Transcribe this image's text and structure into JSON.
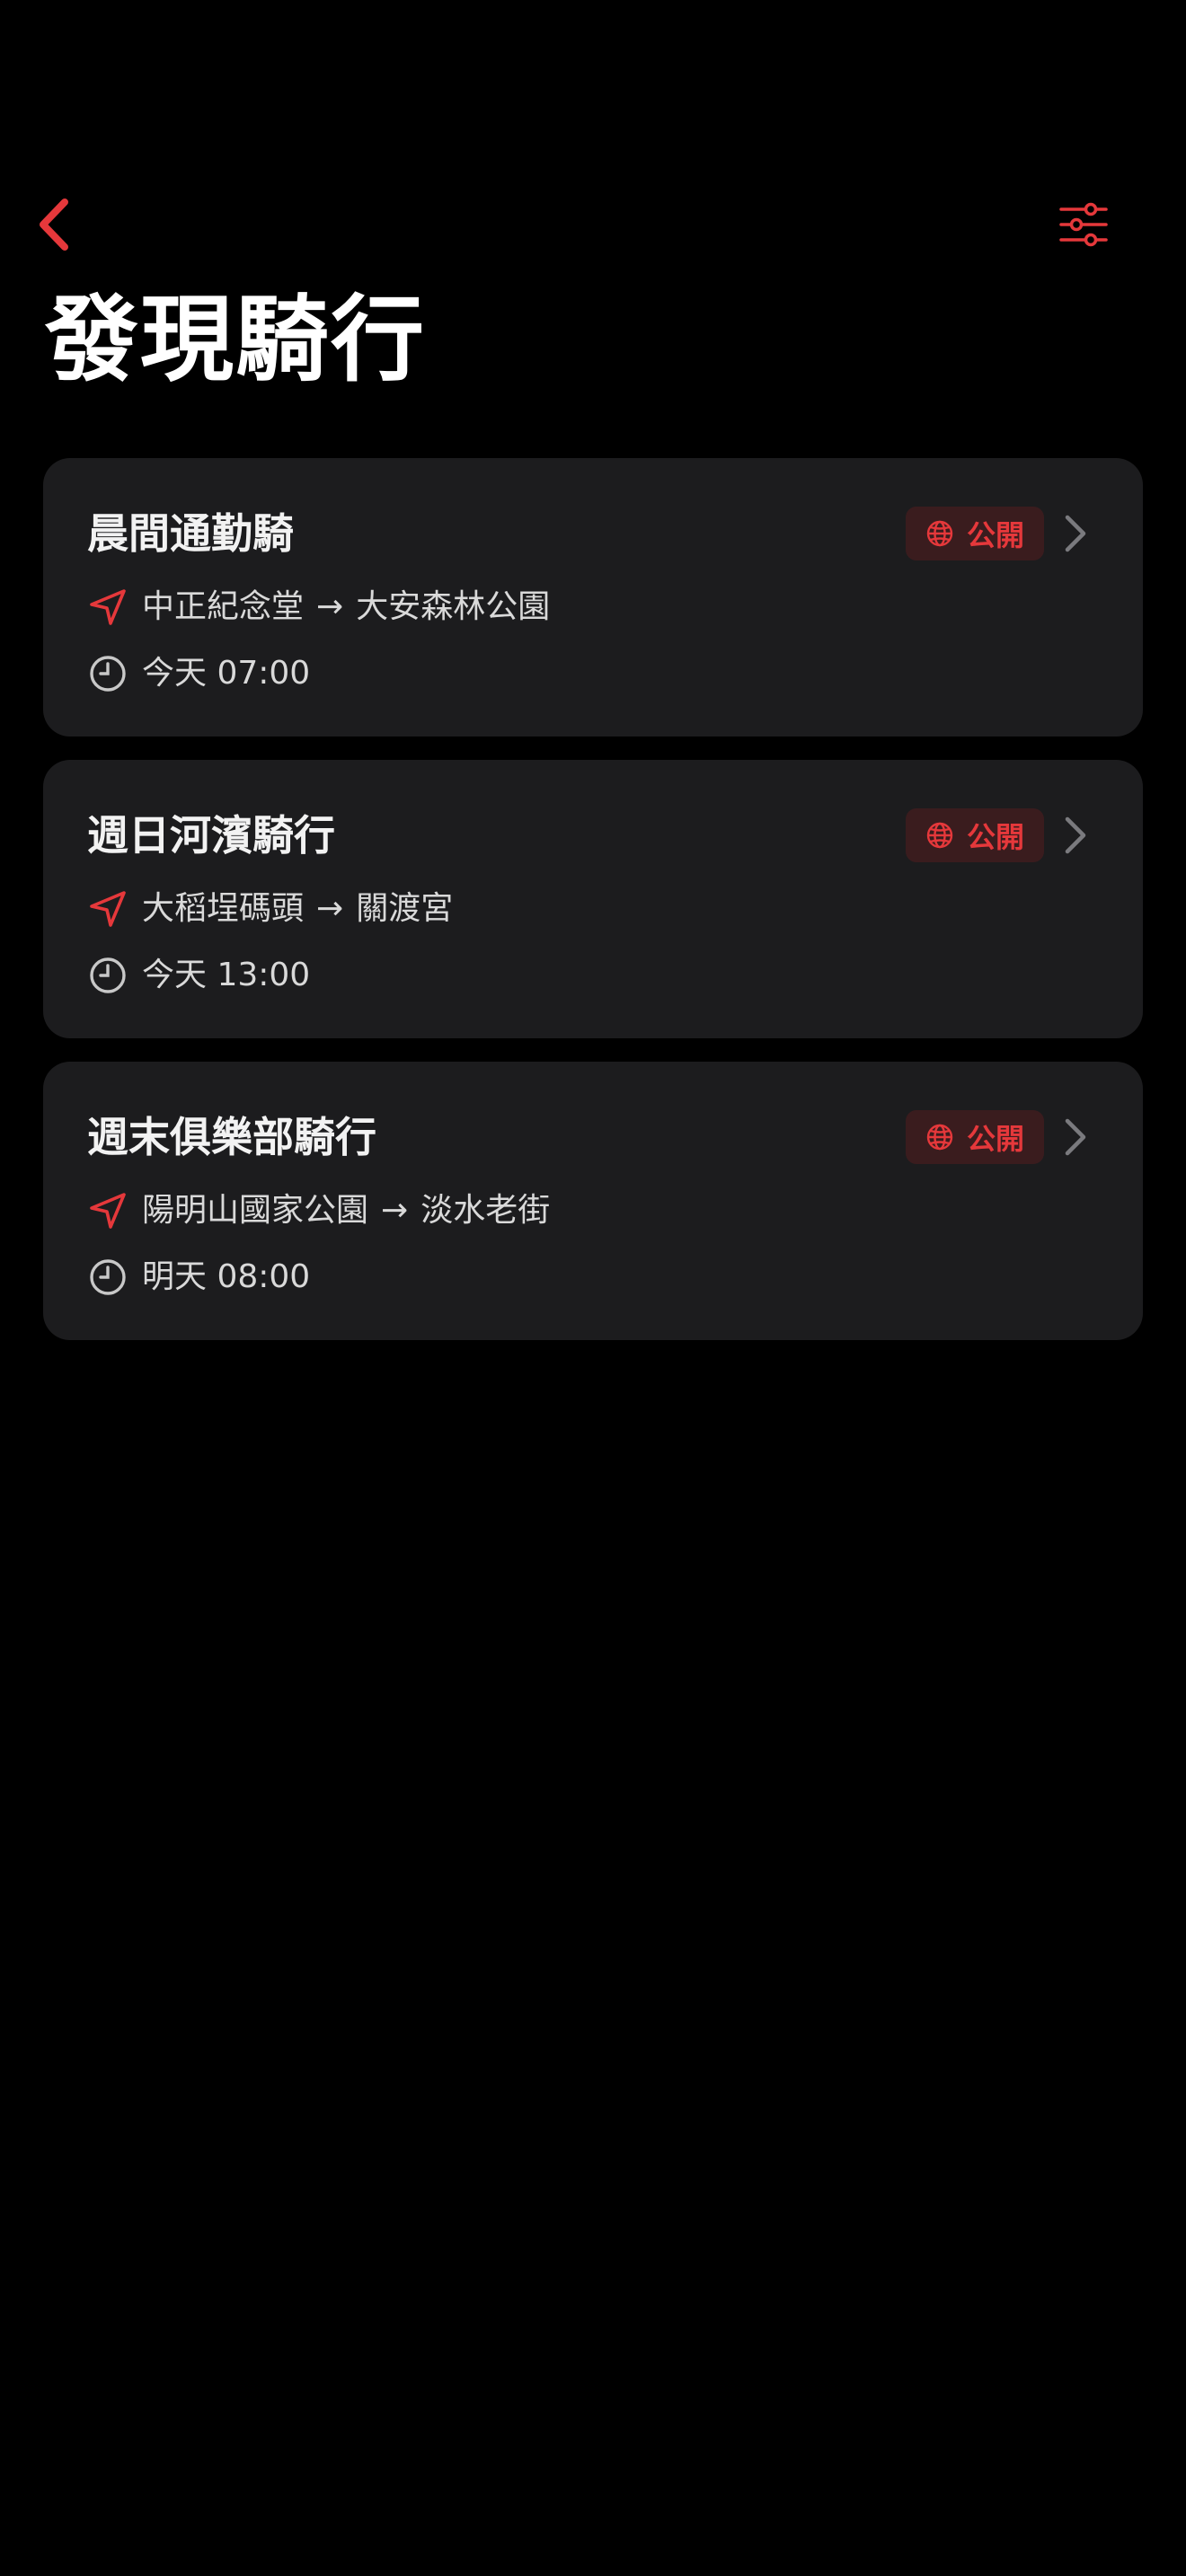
{
  "header": {
    "title": "發現騎行"
  },
  "colors": {
    "accent": "#e5383b",
    "card_background": "#1c1c1e",
    "badge_background": "#3a1c1e",
    "background": "#000000"
  },
  "icons": {
    "back": "chevron-left-icon",
    "filter": "sliders-icon",
    "badge": "globe-icon",
    "route": "navigation-arrow-icon",
    "time": "clock-icon",
    "card_action": "chevron-right-icon"
  },
  "rides": [
    {
      "title": "晨間通勤騎",
      "badge": "公開",
      "from": "中正紀念堂",
      "arrow": "→",
      "to": "大安森林公園",
      "time": "今天 07:00"
    },
    {
      "title": "週日河濱騎行",
      "badge": "公開",
      "from": "大稻埕碼頭",
      "arrow": "→",
      "to": "關渡宮",
      "time": "今天 13:00"
    },
    {
      "title": "週末俱樂部騎行",
      "badge": "公開",
      "from": "陽明山國家公園",
      "arrow": "→",
      "to": "淡水老街",
      "time": "明天 08:00"
    }
  ]
}
